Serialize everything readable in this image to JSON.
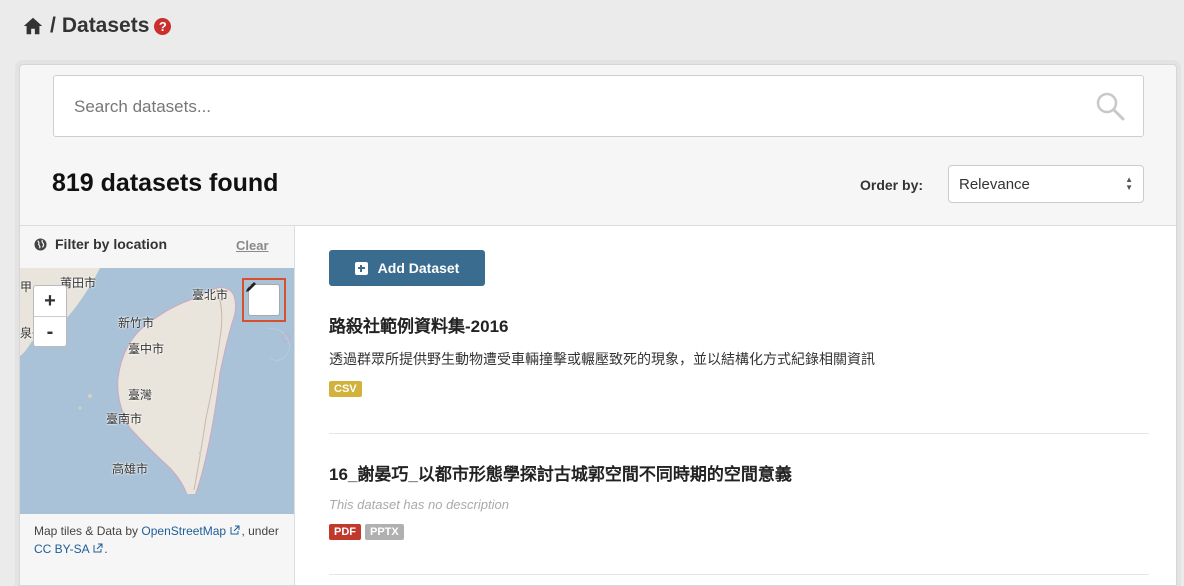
{
  "breadcrumb": {
    "home_icon": "home-icon",
    "separator": "/",
    "title": "Datasets",
    "help_glyph": "?"
  },
  "search": {
    "placeholder": "Search datasets...",
    "value": ""
  },
  "results": {
    "count_text": "819 datasets found"
  },
  "order": {
    "label": "Order by:",
    "selected": "Relevance"
  },
  "filter": {
    "title": "Filter by location",
    "clear_label": "Clear"
  },
  "map": {
    "zoom_in": "+",
    "zoom_out": "-",
    "labels": [
      "莆田市",
      "臺北市",
      "新竹市",
      "臺中市",
      "臺灣",
      "臺南市",
      "高雄市",
      "甲",
      "泉州"
    ],
    "attribution": {
      "prefix": "Map tiles & Data by ",
      "osm_link": "OpenStreetMap",
      "middle": ", under ",
      "license_link": "CC BY-SA",
      "suffix": "."
    }
  },
  "add_dataset_label": "Add Dataset",
  "datasets": [
    {
      "title": "路殺社範例資料集-2016",
      "description": "透過群眾所提供野生動物遭受車輛撞擊或輾壓致死的現象，並以結構化方式紀錄相關資訊",
      "formats": [
        {
          "label": "CSV",
          "color": "#d2b23a"
        }
      ]
    },
    {
      "title": "16_謝晏巧_以都市形態學探討古城郭空間不同時期的空間意義",
      "description": "This dataset has no description",
      "formats": [
        {
          "label": "PDF",
          "color": "#c0392b"
        },
        {
          "label": "PPTX",
          "color": "#b0b0b0"
        }
      ]
    }
  ],
  "colors": {
    "accent": "#3a6c8f",
    "highlight": "#d9502d",
    "help": "#c9302c"
  }
}
